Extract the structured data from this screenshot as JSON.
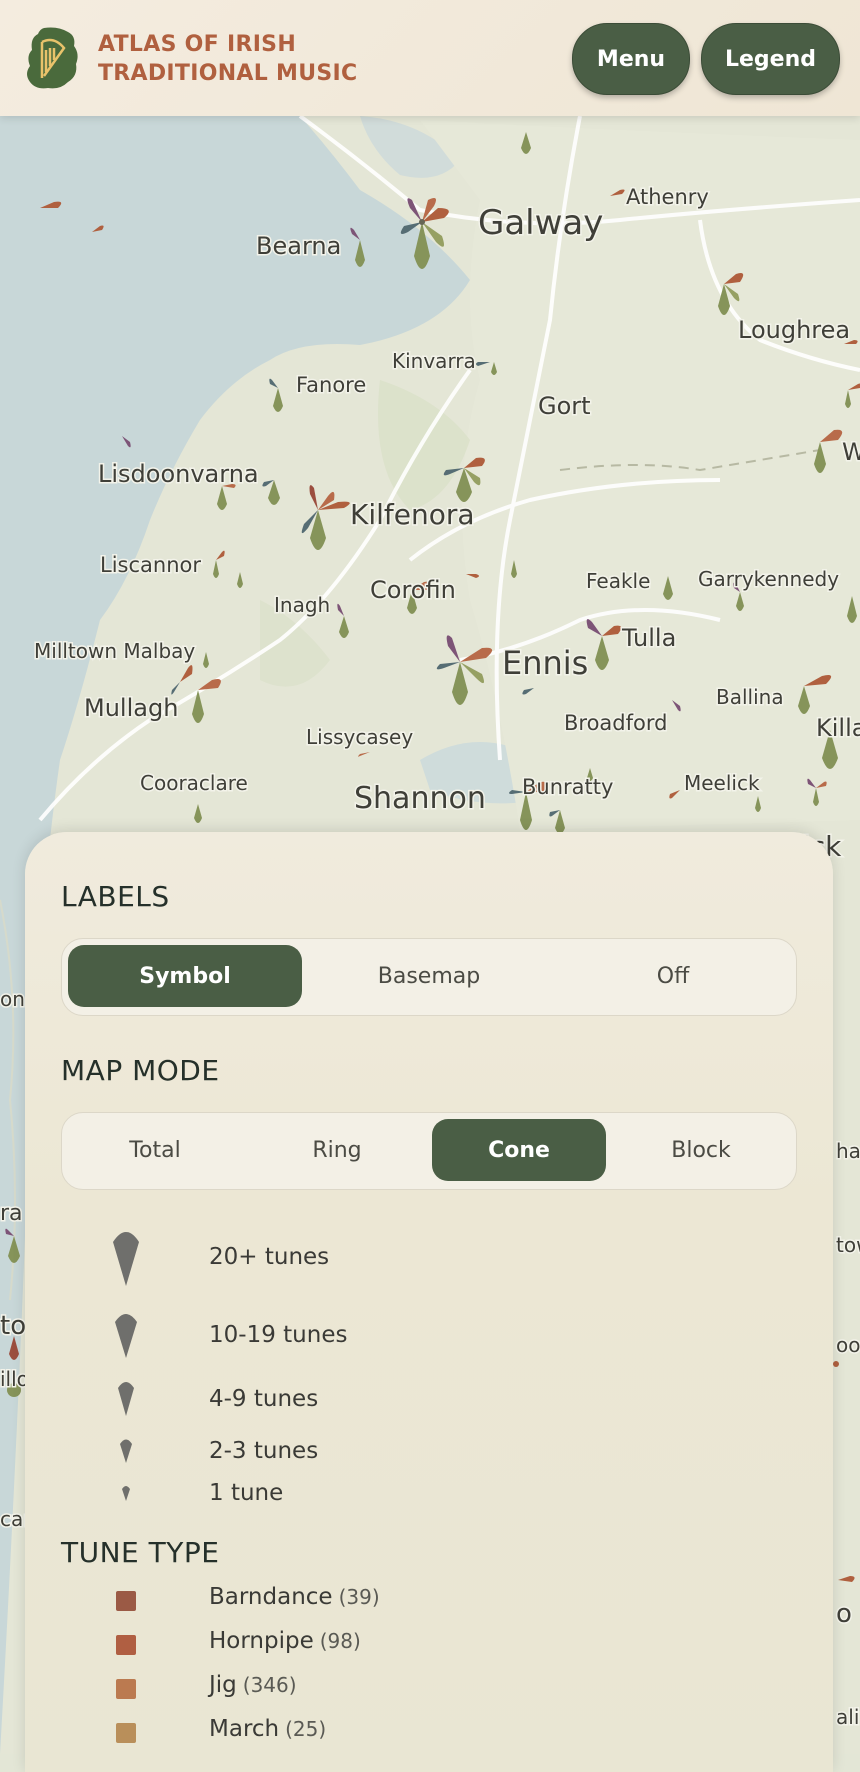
{
  "header": {
    "title_line1": "ATLAS OF IRISH",
    "title_line2": "TRADITIONAL MUSIC",
    "menu_label": "Menu",
    "legend_label": "Legend"
  },
  "map": {
    "places": [
      {
        "name": "Galway"
      },
      {
        "name": "Athenry"
      },
      {
        "name": "Bearna"
      },
      {
        "name": "Loughrea"
      },
      {
        "name": "Kinvarra"
      },
      {
        "name": "Fanore"
      },
      {
        "name": "Gort"
      },
      {
        "name": "Lisdoonvarna"
      },
      {
        "name": "Kilfenora"
      },
      {
        "name": "Liscannor"
      },
      {
        "name": "Corofin"
      },
      {
        "name": "Feakle"
      },
      {
        "name": "Garrykennedy"
      },
      {
        "name": "Inagh"
      },
      {
        "name": "Tulla"
      },
      {
        "name": "Milltown Malbay"
      },
      {
        "name": "Ennis"
      },
      {
        "name": "Mullagh"
      },
      {
        "name": "Ballina"
      },
      {
        "name": "Broadford"
      },
      {
        "name": "Lissycasey"
      },
      {
        "name": "Cooraclare"
      },
      {
        "name": "Shannon"
      },
      {
        "name": "Bunratty"
      },
      {
        "name": "Meelick"
      }
    ],
    "edge_fragments": [
      "W",
      "Killa",
      "ick",
      "on",
      "ra",
      "to",
      "illo",
      "car",
      "han",
      "tow",
      "oo",
      "o",
      "alin"
    ]
  },
  "panel": {
    "labels_heading": "LABELS",
    "labels_options": [
      "Symbol",
      "Basemap",
      "Off"
    ],
    "labels_selected": "Symbol",
    "mapmode_heading": "MAP MODE",
    "mapmode_options": [
      "Total",
      "Ring",
      "Cone",
      "Block"
    ],
    "mapmode_selected": "Cone",
    "size_legend": [
      {
        "label": "20+ tunes"
      },
      {
        "label": "10-19 tunes"
      },
      {
        "label": "4-9 tunes"
      },
      {
        "label": "2-3 tunes"
      },
      {
        "label": "1 tune"
      }
    ],
    "tunetype_heading": "TUNE TYPE",
    "tune_types": [
      {
        "name": "Barndance",
        "count": "(39)",
        "color": "#9b5a45"
      },
      {
        "name": "Hornpipe",
        "count": "(98)",
        "color": "#b05f42"
      },
      {
        "name": "Jig",
        "count": "(346)",
        "color": "#bb7a50"
      },
      {
        "name": "March",
        "count": "(25)",
        "color": "#b98f5a"
      }
    ]
  },
  "colors": {
    "accent": "#4a5e45",
    "title": "#b0603f",
    "water": "#c9d8d9",
    "land": "#e3e6d6"
  }
}
